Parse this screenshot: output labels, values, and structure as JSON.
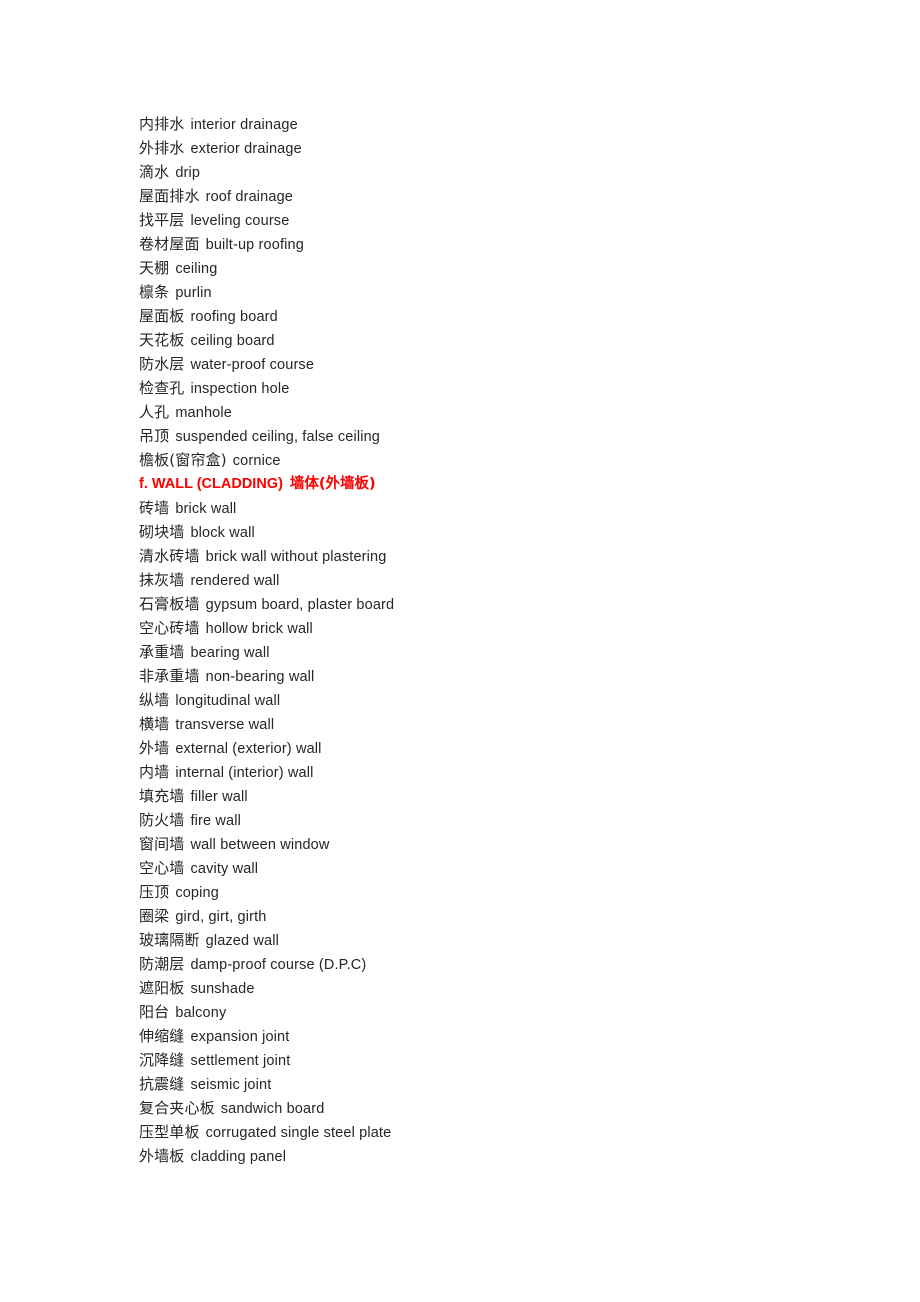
{
  "document": {
    "text_color": "#262626",
    "heading_color": "#ff0000",
    "background_color": "#ffffff",
    "lines": [
      {
        "kind": "entry",
        "term": "内排水",
        "gloss": "interior drainage"
      },
      {
        "kind": "entry",
        "term": "外排水",
        "gloss": "exterior drainage"
      },
      {
        "kind": "entry",
        "term": "滴水",
        "gloss": "drip"
      },
      {
        "kind": "entry",
        "term": "屋面排水",
        "gloss": "roof drainage"
      },
      {
        "kind": "entry",
        "term": "找平层",
        "gloss": "leveling course"
      },
      {
        "kind": "entry",
        "term": "卷材屋面",
        "gloss": "built-up roofing"
      },
      {
        "kind": "entry",
        "term": "天棚",
        "gloss": "ceiling"
      },
      {
        "kind": "entry",
        "term": "檩条",
        "gloss": "purlin"
      },
      {
        "kind": "entry",
        "term": "屋面板",
        "gloss": "roofing board"
      },
      {
        "kind": "entry",
        "term": "天花板",
        "gloss": "ceiling board"
      },
      {
        "kind": "entry",
        "term": "防水层",
        "gloss": "water-proof course"
      },
      {
        "kind": "entry",
        "term": "检查孔",
        "gloss": "inspection hole"
      },
      {
        "kind": "entry",
        "term": "人孔",
        "gloss": "manhole"
      },
      {
        "kind": "entry",
        "term": "吊顶",
        "gloss": "suspended ceiling, false ceiling"
      },
      {
        "kind": "entry",
        "term": "檐板(窗帘盒)",
        "gloss": "cornice"
      },
      {
        "kind": "heading",
        "label_en": "f. WALL (CLADDING)",
        "label_cn": "墙体(外墙板)"
      },
      {
        "kind": "entry",
        "term": "砖墙",
        "gloss": "brick wall"
      },
      {
        "kind": "entry",
        "term": "砌块墙",
        "gloss": "block wall"
      },
      {
        "kind": "entry",
        "term": "清水砖墙",
        "gloss": "brick wall without plastering"
      },
      {
        "kind": "entry",
        "term": "抹灰墙",
        "gloss": "rendered wall"
      },
      {
        "kind": "entry",
        "term": "石膏板墙",
        "gloss": "gypsum board, plaster board"
      },
      {
        "kind": "entry",
        "term": "空心砖墙",
        "gloss": "hollow brick wall"
      },
      {
        "kind": "entry",
        "term": "承重墙",
        "gloss": "bearing wall"
      },
      {
        "kind": "entry",
        "term": "非承重墙",
        "gloss": "non-bearing wall"
      },
      {
        "kind": "entry",
        "term": "纵墙",
        "gloss": "longitudinal wall"
      },
      {
        "kind": "entry",
        "term": "横墙",
        "gloss": "transverse wall"
      },
      {
        "kind": "entry",
        "term": "外墙",
        "gloss": "external (exterior) wall"
      },
      {
        "kind": "entry",
        "term": "内墙",
        "gloss": "internal (interior) wall"
      },
      {
        "kind": "entry",
        "term": "填充墙",
        "gloss": "filler wall"
      },
      {
        "kind": "entry",
        "term": "防火墙",
        "gloss": "fire wall"
      },
      {
        "kind": "entry",
        "term": "窗间墙",
        "gloss": "wall between window"
      },
      {
        "kind": "entry",
        "term": "空心墙",
        "gloss": "cavity wall"
      },
      {
        "kind": "entry",
        "term": "压顶",
        "gloss": "coping"
      },
      {
        "kind": "entry",
        "term": "圈梁",
        "gloss": "gird, girt, girth"
      },
      {
        "kind": "entry",
        "term": "玻璃隔断",
        "gloss": "glazed wall"
      },
      {
        "kind": "entry",
        "term": "防潮层",
        "gloss": "damp-proof course (D.P.C)"
      },
      {
        "kind": "entry",
        "term": "遮阳板",
        "gloss": "sunshade"
      },
      {
        "kind": "entry",
        "term": "阳台",
        "gloss": "balcony"
      },
      {
        "kind": "entry",
        "term": "伸缩缝",
        "gloss": "expansion joint"
      },
      {
        "kind": "entry",
        "term": "沉降缝",
        "gloss": "settlement joint"
      },
      {
        "kind": "entry",
        "term": "抗震缝",
        "gloss": "seismic joint"
      },
      {
        "kind": "entry",
        "term": "复合夹心板",
        "gloss": "sandwich board"
      },
      {
        "kind": "entry",
        "term": "压型单板",
        "gloss": "corrugated single steel plate"
      },
      {
        "kind": "entry",
        "term": "外墙板",
        "gloss": "cladding panel"
      }
    ]
  }
}
